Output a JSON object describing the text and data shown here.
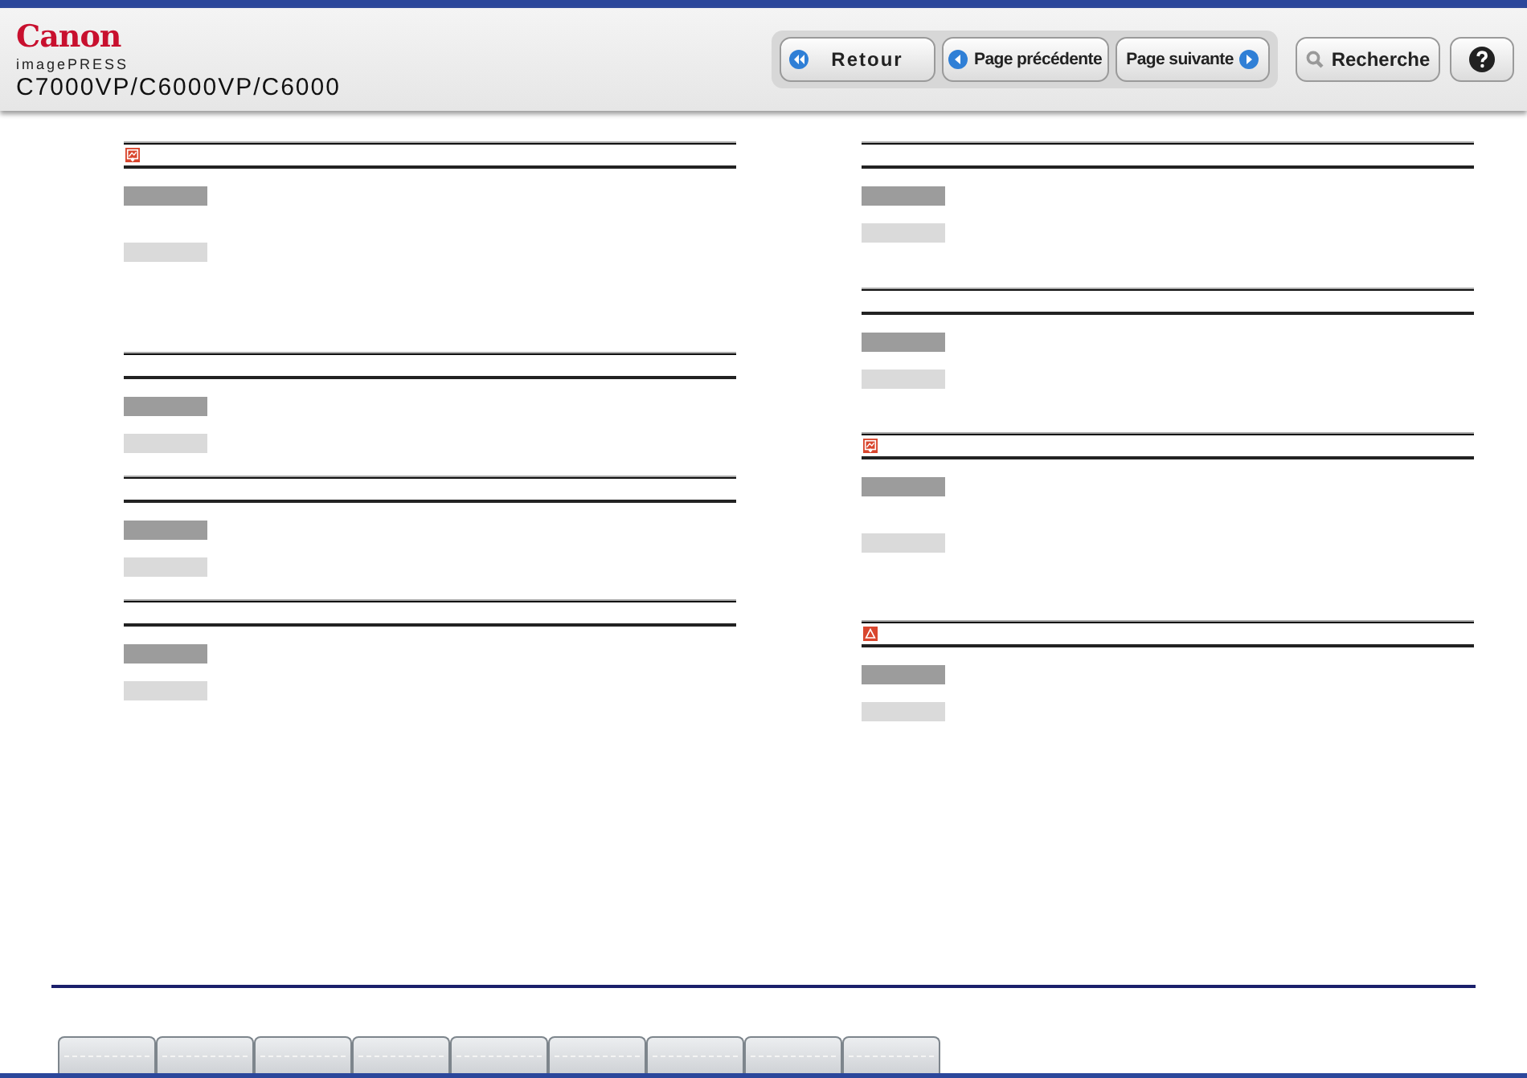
{
  "header": {
    "brand": "Canon",
    "product_line": "imagePRESS",
    "models": "C7000VP/C6000VP/C6000"
  },
  "nav_buttons": [
    {
      "kind": "back",
      "label": "Retour"
    },
    {
      "kind": "prev",
      "label": "Page précédente"
    },
    {
      "kind": "next",
      "label": "Page suivante"
    }
  ],
  "tool_buttons": [
    {
      "kind": "search",
      "label": "Recherche"
    },
    {
      "kind": "help"
    }
  ],
  "columns": [
    [
      {
        "kind": "image"
      },
      {
        "kind": "plain"
      },
      {
        "kind": "plain"
      },
      {
        "kind": "plain"
      }
    ],
    [
      {
        "kind": "plain"
      },
      {
        "kind": "plain"
      },
      {
        "kind": "image"
      },
      {
        "kind": "warning"
      }
    ]
  ],
  "bottom_tabs": [
    {
      "selected": false
    },
    {
      "selected": false
    },
    {
      "selected": false
    },
    {
      "selected": false
    },
    {
      "selected": false
    },
    {
      "selected": false
    },
    {
      "selected": false
    },
    {
      "selected": false
    },
    {
      "selected": false
    }
  ]
}
